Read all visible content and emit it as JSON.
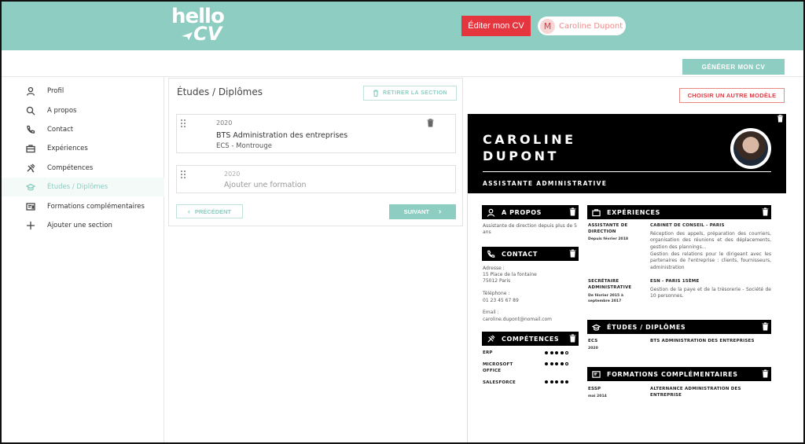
{
  "header": {
    "logo_line1": "hello",
    "logo_line2": "CV",
    "edit_button": "Éditer mon CV",
    "user_initial": "M",
    "user_name": "Caroline Dupont"
  },
  "toolbar": {
    "generate_button": "GÉNÉRER MON CV",
    "choose_model_button": "CHOISIR UN AUTRE MODÈLE"
  },
  "sidebar": {
    "items": [
      {
        "label": "Profil",
        "icon": "user-icon"
      },
      {
        "label": "A propos",
        "icon": "search-icon"
      },
      {
        "label": "Contact",
        "icon": "phone-icon"
      },
      {
        "label": "Expériences",
        "icon": "briefcase-icon"
      },
      {
        "label": "Compétences",
        "icon": "tools-icon"
      },
      {
        "label": "Études / Diplômes",
        "icon": "graduation-icon",
        "active": true
      },
      {
        "label": "Formations complémentaires",
        "icon": "certificate-icon"
      },
      {
        "label": "Ajouter une section",
        "icon": "plus-icon"
      }
    ]
  },
  "editor": {
    "title": "Études / Diplômes",
    "remove_section": "RETIRER LA SECTION",
    "entries": [
      {
        "year": "2020",
        "title": "BTS Administration des entreprises",
        "school": "ECS - Montrouge"
      }
    ],
    "new_entry": {
      "year": "2020",
      "title": "Ajouter une formation"
    },
    "prev_button": "PRÉCÉDENT",
    "next_button": "SUIVANT"
  },
  "cv": {
    "first_name": "CAROLINE",
    "last_name": "DUPONT",
    "job_title": "ASSISTANTE ADMINISTRATIVE",
    "about": {
      "heading": "A PROPOS",
      "text": "Assistante de direction depuis plus de 5 ans"
    },
    "contact": {
      "heading": "CONTACT",
      "address_label": "Adresse :",
      "address_line1": "15 Place de la fontaine",
      "address_line2": "75012 Paris",
      "phone_label": "Téléphone :",
      "phone": "01 23 45 67 89",
      "email_label": "Email :",
      "email": "caroline.dupont@nomail.com"
    },
    "skills": {
      "heading": "COMPÉTENCES",
      "items": [
        {
          "name": "ERP",
          "level": 4
        },
        {
          "name": "MICROSOFT OFFICE",
          "level": 4
        },
        {
          "name": "SALESFORCE",
          "level": 5
        }
      ],
      "max_level": 5
    },
    "experiences": {
      "heading": "EXPÉRIENCES",
      "items": [
        {
          "role": "ASSISTANTE DE DIRECTION",
          "date": "Depuis février 2018",
          "company": "CABINET DE CONSEIL - PARIS",
          "description": "Réception des appels, préparation des courriers, organisation des réunions et des déplacements, gestion des plannings...",
          "description2": "Gestion des relations pour le dirigeant avec les partenaires de l'entreprise : clients, fournisseurs, administration"
        },
        {
          "role": "SECRÉTAIRE ADMINISTRATIVE",
          "date": "De février 2015 à septembre 2017",
          "company": "ESN - PARIS 15ÈME",
          "description": "Gestion de la paye et de la trésorerie - Société de 10 personnes."
        }
      ]
    },
    "education": {
      "heading": "ÉTUDES / DIPLÔMES",
      "items": [
        {
          "school": "ECS",
          "year": "2020",
          "title": "BTS ADMINISTRATION DES ENTREPRISES"
        }
      ]
    },
    "trainings": {
      "heading": "FORMATIONS COMPLÉMENTAIRES",
      "items": [
        {
          "school": "ESSP",
          "date": "mai 2014",
          "title": "ALTERNANCE ADMINISTRATION DES ENTREPRISE"
        }
      ]
    }
  }
}
